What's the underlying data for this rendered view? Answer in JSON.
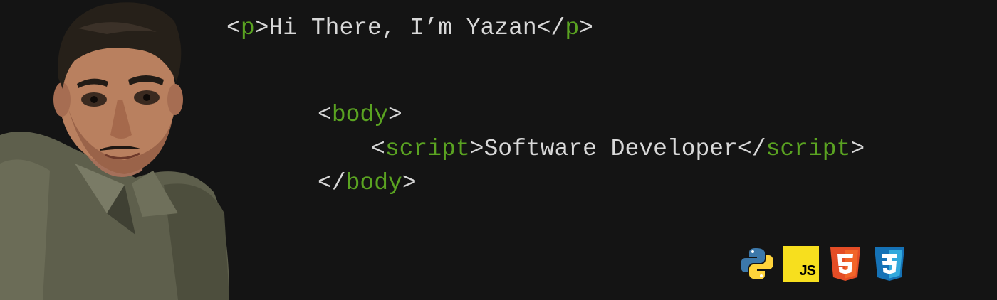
{
  "intro": {
    "open_tag": "p",
    "text": "Hi There, I’m Yazan",
    "close_tag": "p"
  },
  "body_open": {
    "tag": "body"
  },
  "script_line": {
    "open_tag": "script",
    "text": "Software Developer",
    "close_tag": "script"
  },
  "body_close": {
    "tag": "body"
  },
  "tech": {
    "icons": [
      "python-icon",
      "javascript-icon",
      "html5-icon",
      "css3-icon"
    ],
    "js_label": "JS"
  },
  "colors": {
    "background": "#141414",
    "text": "#d8d8d8",
    "tag": "#5aa321"
  }
}
